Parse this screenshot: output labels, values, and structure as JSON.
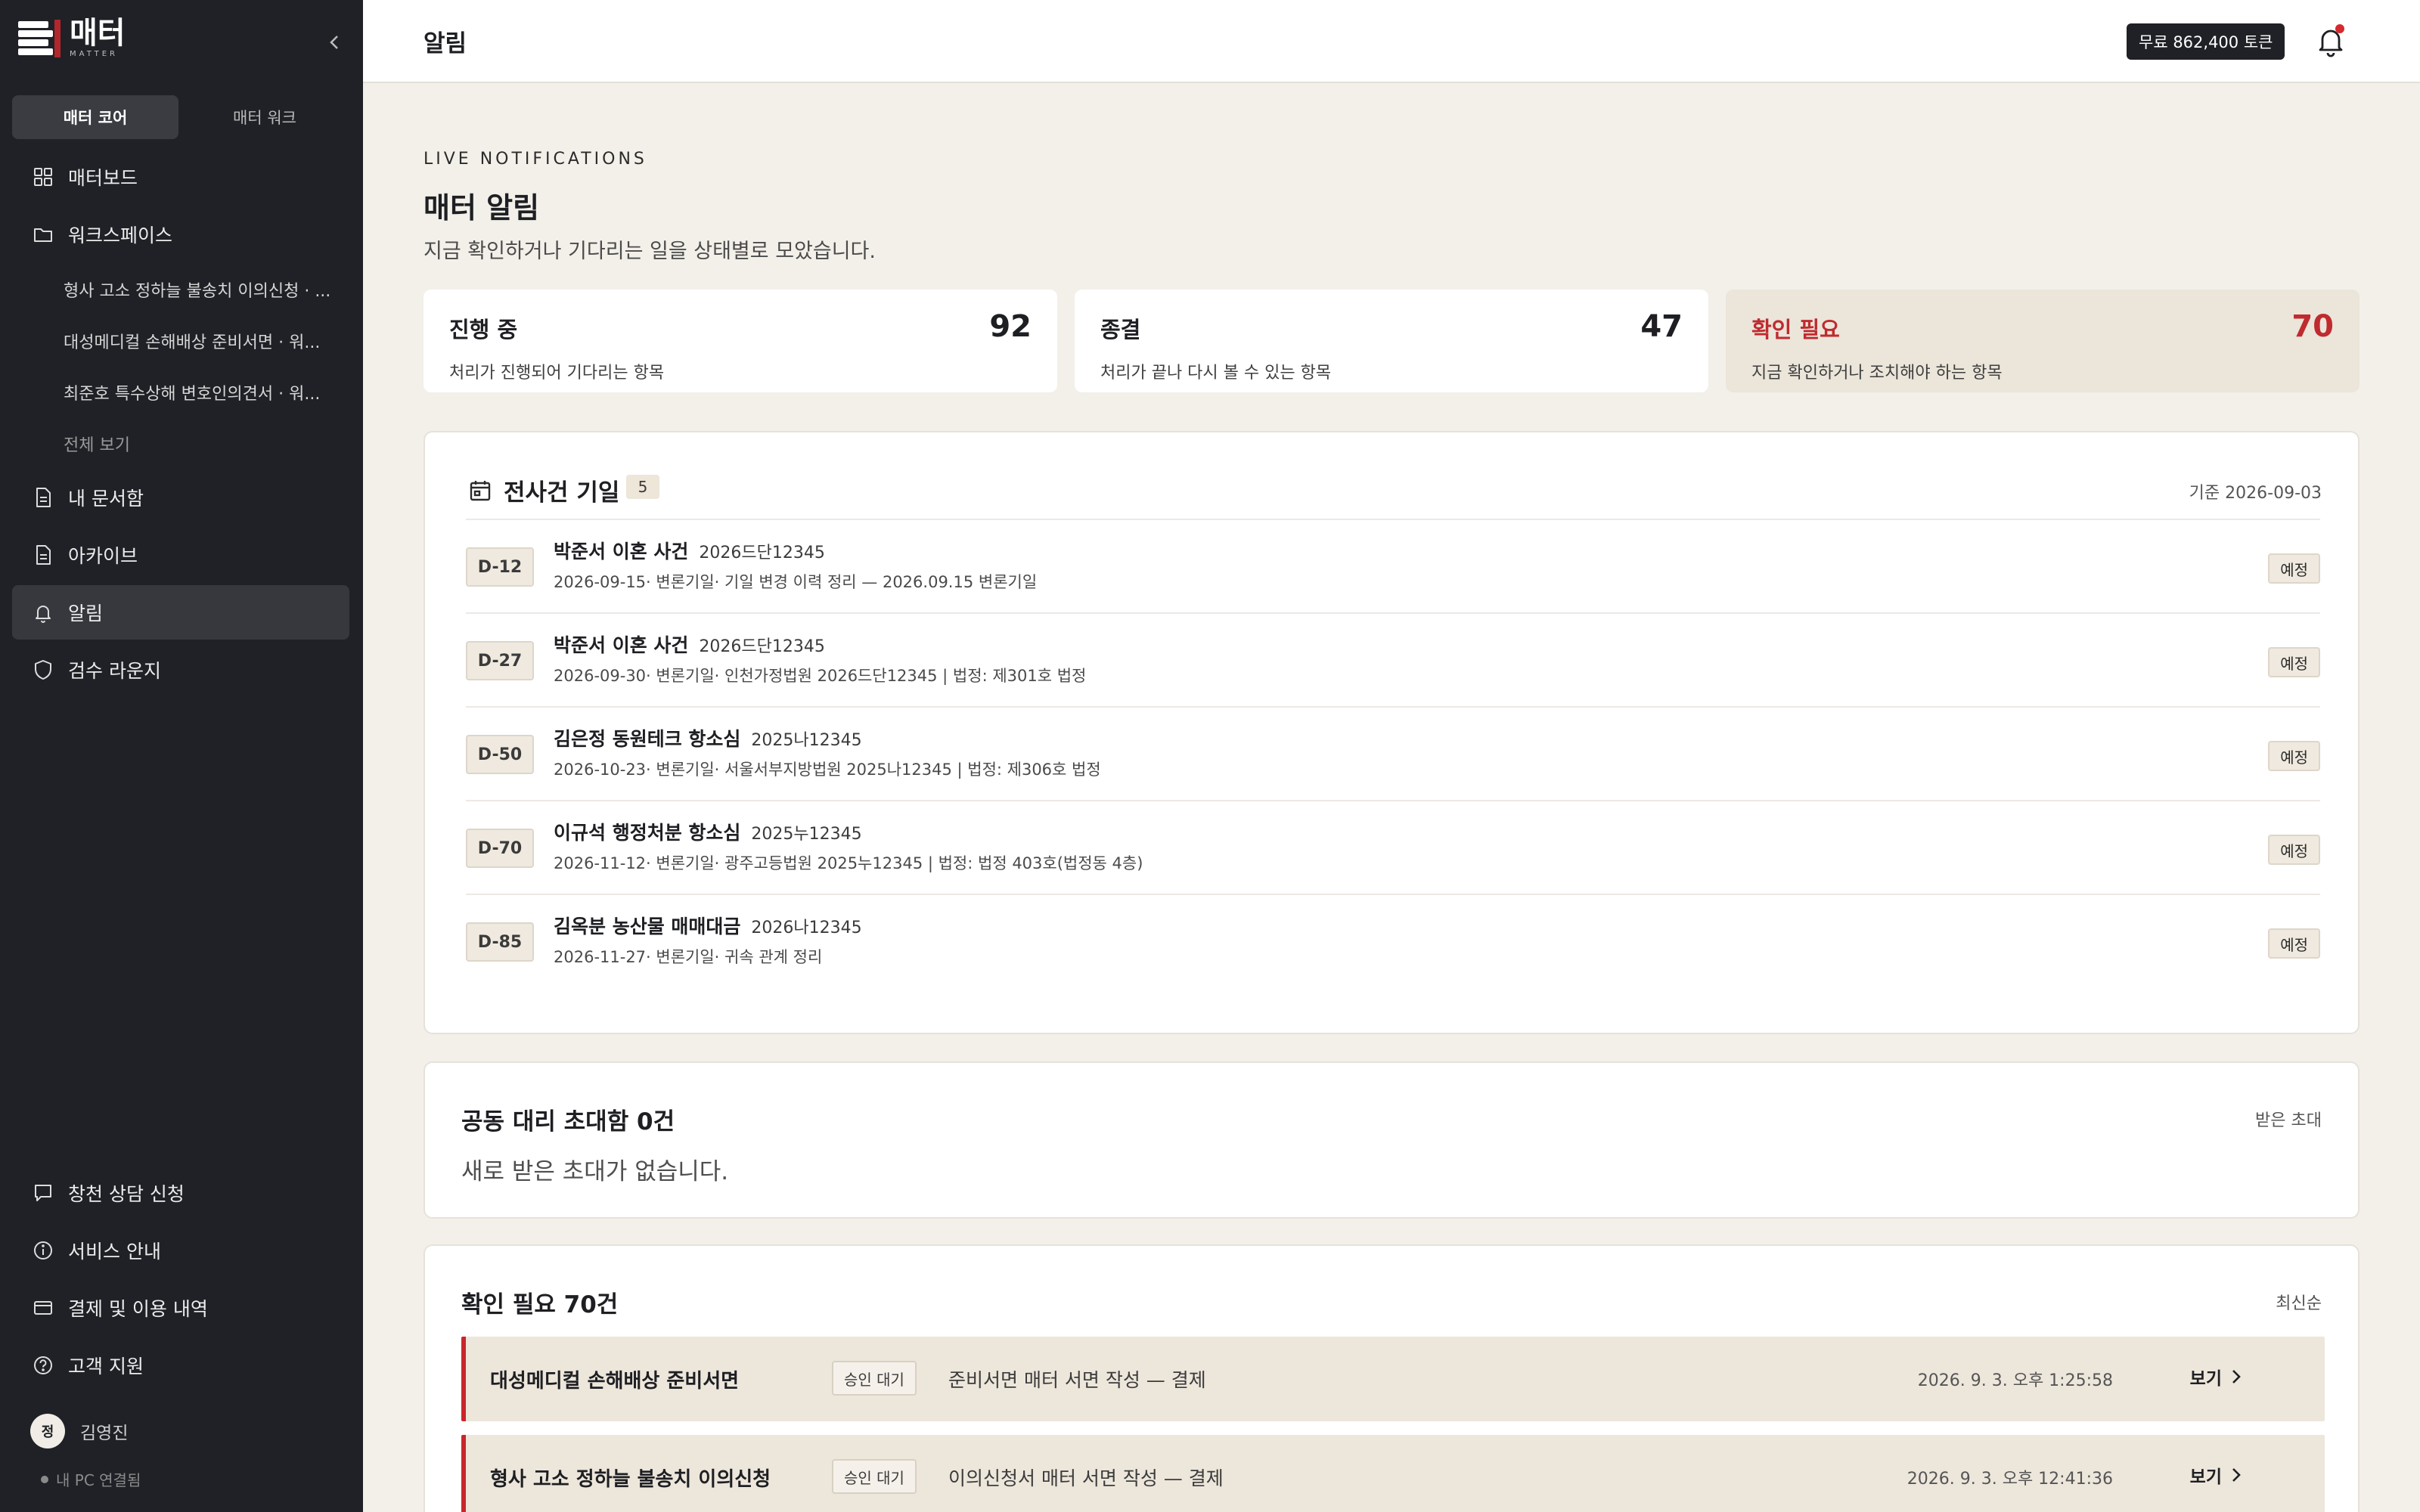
{
  "app": {
    "logo_kr": "매터",
    "logo_en": "MATTER"
  },
  "sidebar": {
    "segments": [
      "매터 코어",
      "매터 워크"
    ],
    "nav": [
      {
        "label": "매터보드",
        "icon": "grid-icon"
      },
      {
        "label": "워크스페이스",
        "icon": "folder-icon"
      },
      {
        "label": "내 문서함",
        "icon": "document-icon"
      },
      {
        "label": "아카이브",
        "icon": "archive-icon"
      },
      {
        "label": "알림",
        "icon": "bell-icon"
      },
      {
        "label": "검수 라운지",
        "icon": "shield-icon"
      }
    ],
    "workspace_items": [
      "형사 고소 정하늘 불송치 이의신청 · ...",
      "대성메디컬 손해배상 준비서면 · 워...",
      "최준호 특수상해 변호인의견서 · 워...",
      "전체 보기"
    ],
    "bottom_nav": [
      {
        "label": "창천 상담 신청",
        "icon": "chat-icon"
      },
      {
        "label": "서비스 안내",
        "icon": "info-icon"
      },
      {
        "label": "결제 및 이용 내역",
        "icon": "card-icon"
      },
      {
        "label": "고객 지원",
        "icon": "help-icon"
      }
    ],
    "user": {
      "initial": "정",
      "name": "김영진"
    },
    "pc_link": "내 PC 연결됨"
  },
  "topbar": {
    "title": "알림",
    "token_badge": "무료 862,400 토큰"
  },
  "main": {
    "eyebrow": "LIVE NOTIFICATIONS",
    "title": "매터 알림",
    "subtitle": "지금 확인하거나 기다리는 일을 상태별로 모았습니다.",
    "stats": [
      {
        "label": "진행 중",
        "value": "92",
        "desc": "처리가 진행되어 기다리는 항목"
      },
      {
        "label": "종결",
        "value": "47",
        "desc": "처리가 끝나 다시 볼 수 있는 항목"
      },
      {
        "label": "확인 필요",
        "value": "70",
        "desc": "지금 확인하거나 조치해야 하는 항목"
      }
    ],
    "deadlines": {
      "title": "전사건 기일",
      "count": "5",
      "base_date": "기준 2026-09-03",
      "items": [
        {
          "dday": "D-12",
          "name": "박준서 이혼 사건",
          "case_no": "2026드단12345",
          "detail": "2026-09-15· 변론기일· 기일 변경 이력 정리 — 2026.09.15 변론기일",
          "status": "예정"
        },
        {
          "dday": "D-27",
          "name": "박준서 이혼 사건",
          "case_no": "2026드단12345",
          "detail": "2026-09-30· 변론기일· 인천가정법원 2026드단12345 | 법정: 제301호 법정",
          "status": "예정"
        },
        {
          "dday": "D-50",
          "name": "김은정 동원테크 항소심",
          "case_no": "2025나12345",
          "detail": "2026-10-23· 변론기일· 서울서부지방법원 2025나12345 | 법정: 제306호 법정",
          "status": "예정"
        },
        {
          "dday": "D-70",
          "name": "이규석 행정처분 항소심",
          "case_no": "2025누12345",
          "detail": "2026-11-12· 변론기일· 광주고등법원 2025누12345 | 법정: 법정 403호(법정동 4층)",
          "status": "예정"
        },
        {
          "dday": "D-85",
          "name": "김옥분 농산물 매매대금",
          "case_no": "2026나12345",
          "detail": "2026-11-27· 변론기일· 귀속 관계 정리",
          "status": "예정"
        }
      ]
    },
    "invites": {
      "title": "공동 대리 초대함 0건",
      "right_label": "받은 초대",
      "empty_text": "새로 받은 초대가 없습니다."
    },
    "needs_check": {
      "title": "확인 필요 70건",
      "sort_label": "최신순",
      "items": [
        {
          "name": "대성메디컬 손해배상 준비서면",
          "chip": "승인 대기",
          "desc": "준비서면 매터 서면 작성 — 결제",
          "time": "2026. 9. 3. 오후 1:25:58",
          "action": "보기"
        },
        {
          "name": "형사 고소 정하늘 불송치 이의신청",
          "chip": "승인 대기",
          "desc": "이의신청서 매터 서면 작성 — 결제",
          "time": "2026. 9. 3. 오후 12:41:36",
          "action": "보기"
        }
      ]
    }
  },
  "colors": {
    "sidebar_bg": "#1f2126",
    "page_bg": "#f3f0ea",
    "accent_red": "#c9262c",
    "alert_card_bg": "#ebe5da"
  }
}
